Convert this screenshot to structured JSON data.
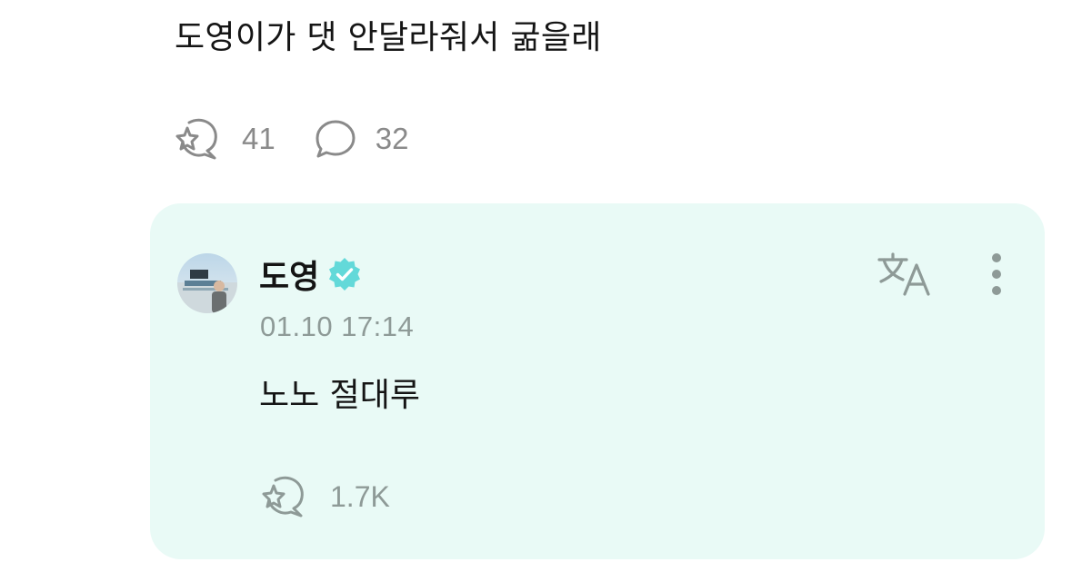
{
  "post": {
    "text": "도영이가 댓 안달라줘서 굶을래",
    "like_count": "41",
    "comment_count": "32",
    "icons": {
      "like": "sparkle-bubble-icon",
      "comment": "speech-bubble-icon"
    }
  },
  "reply": {
    "author": "도영",
    "verified": true,
    "timestamp": "01.10 17:14",
    "text": "노노 절대루",
    "like_count": "1.7K",
    "icons": {
      "verified": "verified-badge-icon",
      "translate": "translate-icon",
      "more": "more-vertical-icon",
      "like": "sparkle-bubble-icon"
    }
  },
  "colors": {
    "card_background": "#e9faf6",
    "verified_badge": "#63d9d9",
    "muted_text": "#8e9a97",
    "text": "#151515"
  }
}
